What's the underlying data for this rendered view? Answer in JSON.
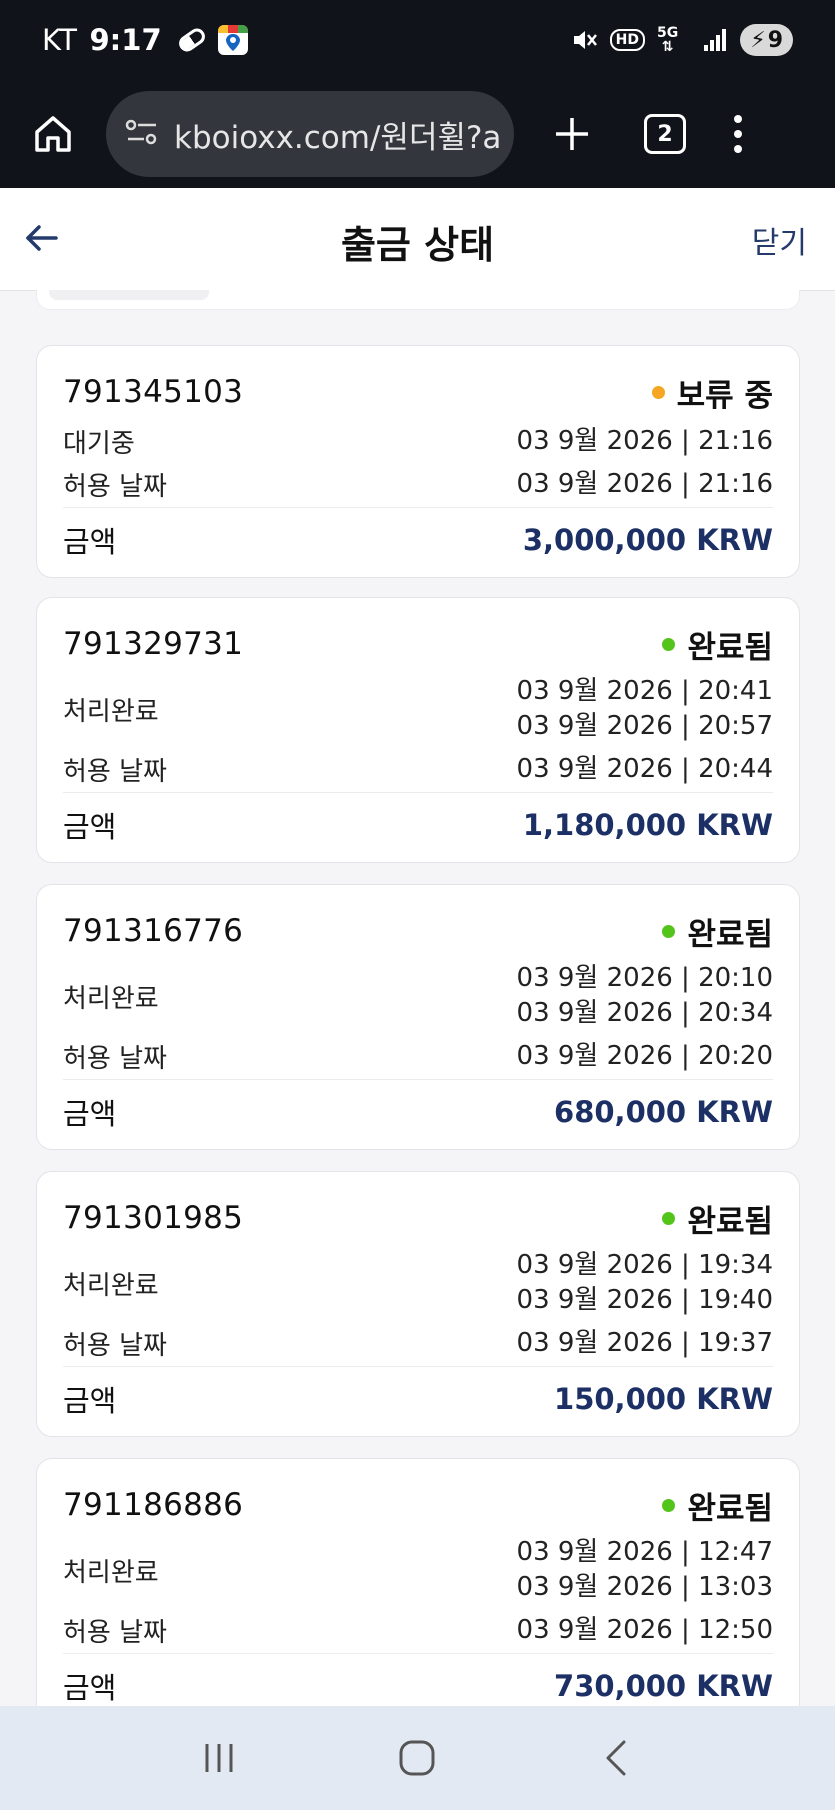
{
  "statusbar": {
    "carrier": "KT",
    "time": "9:17",
    "hd": "HD",
    "net": "5G",
    "battery": "9"
  },
  "browser": {
    "url": "kboioxx.com/원더휠?a",
    "tab_count": "2"
  },
  "header": {
    "title": "출금 상태",
    "close_label": "닫기"
  },
  "colors": {
    "pending": "#f5a623",
    "completed": "#52c41a",
    "amount": "#1c3066"
  },
  "cards": [
    {
      "id": "791345103",
      "status": "보류 중",
      "state_label": "대기중",
      "state_dates": [
        "03 9월 2026 | 21:16"
      ],
      "allow_label": "허용 날짜",
      "allow_date": "03 9월 2026 | 21:16",
      "amount_label": "금액",
      "amount": "3,000,000 KRW"
    },
    {
      "id": "791329731",
      "status": "완료됨",
      "state_label": "처리완료",
      "state_dates": [
        "03 9월 2026 | 20:41",
        "03 9월 2026 | 20:57"
      ],
      "allow_label": "허용 날짜",
      "allow_date": "03 9월 2026 | 20:44",
      "amount_label": "금액",
      "amount": "1,180,000 KRW"
    },
    {
      "id": "791316776",
      "status": "완료됨",
      "state_label": "처리완료",
      "state_dates": [
        "03 9월 2026 | 20:10",
        "03 9월 2026 | 20:34"
      ],
      "allow_label": "허용 날짜",
      "allow_date": "03 9월 2026 | 20:20",
      "amount_label": "금액",
      "amount": "680,000 KRW"
    },
    {
      "id": "791301985",
      "status": "완료됨",
      "state_label": "처리완료",
      "state_dates": [
        "03 9월 2026 | 19:34",
        "03 9월 2026 | 19:40"
      ],
      "allow_label": "허용 날짜",
      "allow_date": "03 9월 2026 | 19:37",
      "amount_label": "금액",
      "amount": "150,000 KRW"
    },
    {
      "id": "791186886",
      "status": "완료됨",
      "state_label": "처리완료",
      "state_dates": [
        "03 9월 2026 | 12:47",
        "03 9월 2026 | 13:03"
      ],
      "allow_label": "허용 날짜",
      "allow_date": "03 9월 2026 | 12:50",
      "amount_label": "금액",
      "amount": "730,000 KRW"
    }
  ]
}
